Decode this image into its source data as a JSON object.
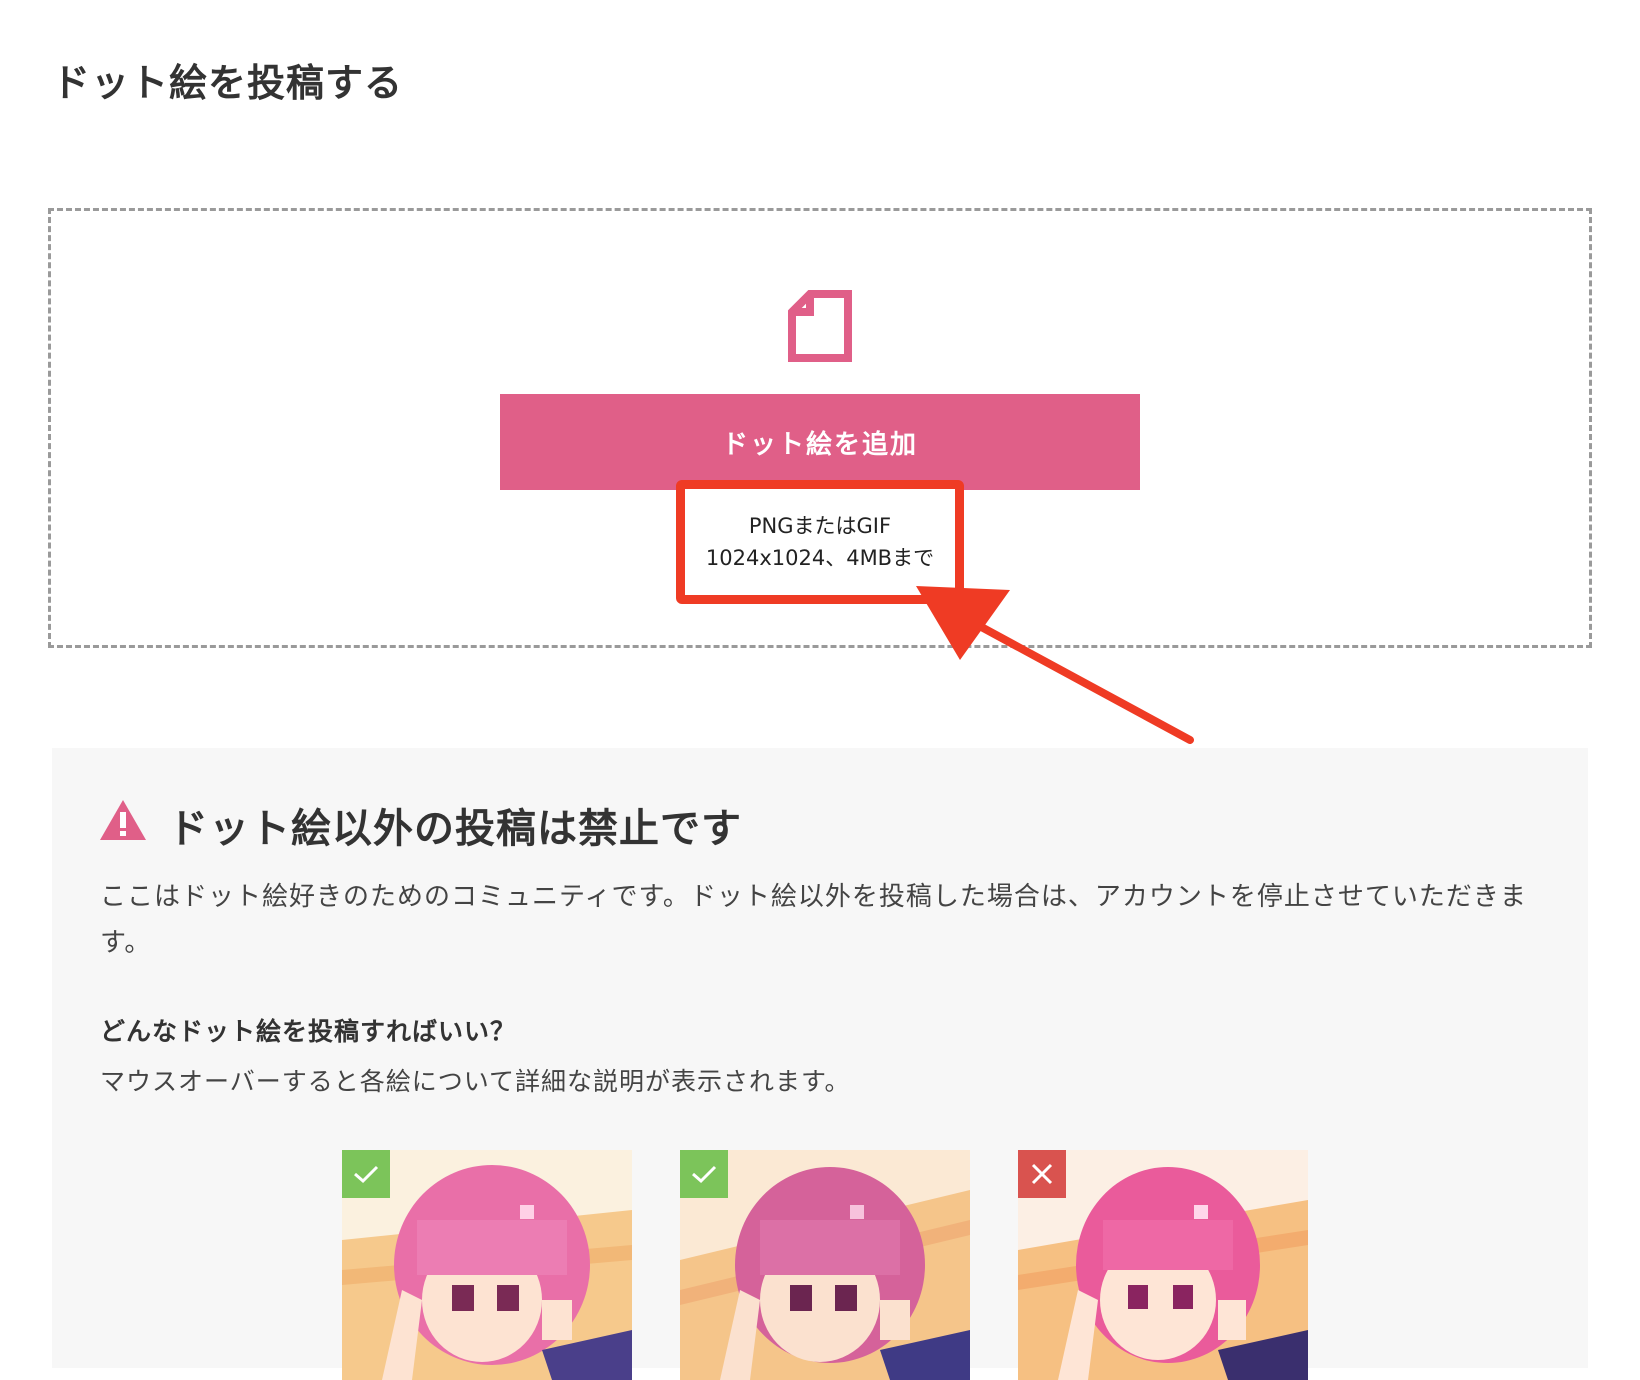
{
  "page": {
    "title": "ドット絵を投稿する"
  },
  "upload": {
    "file_icon": "file-icon",
    "add_button_label": "ドット絵を追加",
    "hint_line1": "PNGまたはGIF",
    "hint_line2": "1024x1024、4MBまで",
    "accent_color": "#e05f88",
    "highlight_color": "#ef3b24"
  },
  "notice": {
    "icon": "warning-icon",
    "heading": "ドット絵以外の投稿は禁止です",
    "body": "ここはドット絵好きのためのコミュニティです。ドット絵以外を投稿した場合は、アカウントを停止させていただきます。",
    "question": "どんなドット絵を投稿すればいい？",
    "description": "マウスオーバーすると各絵について詳細な説明が表示されます。"
  },
  "examples": [
    {
      "status": "ok",
      "badge_icon": "check-icon",
      "badge_color": "#7cc45a"
    },
    {
      "status": "ok",
      "badge_icon": "check-icon",
      "badge_color": "#7cc45a"
    },
    {
      "status": "ng",
      "badge_icon": "cross-icon",
      "badge_color": "#d9534f"
    }
  ]
}
